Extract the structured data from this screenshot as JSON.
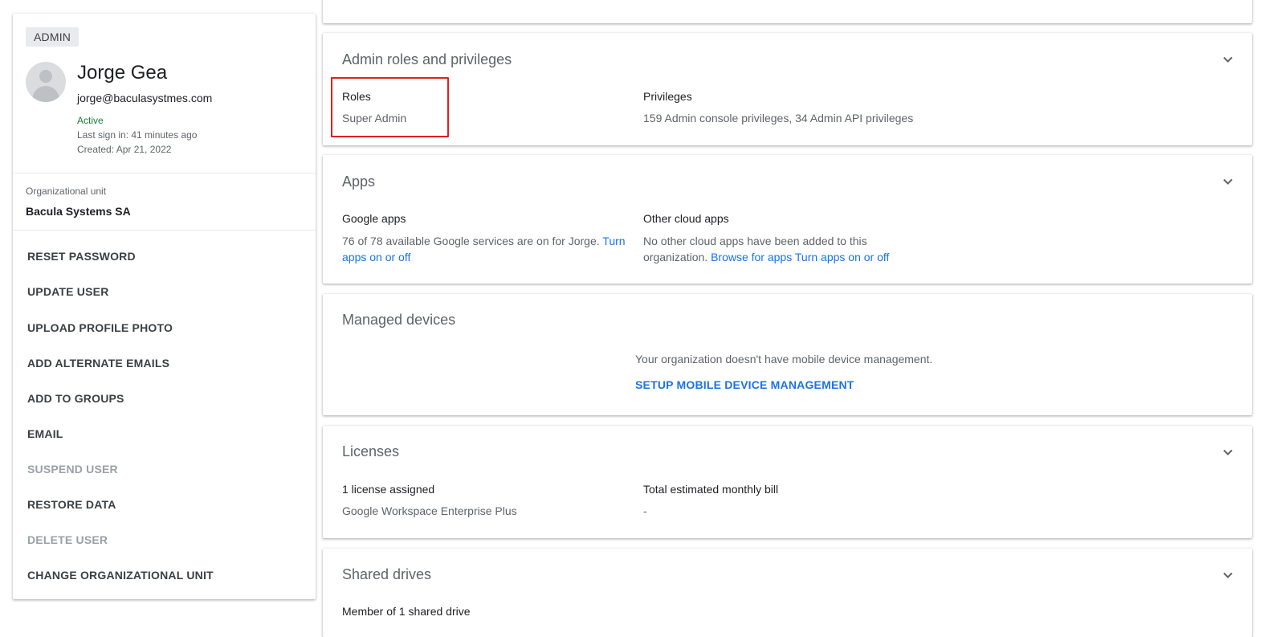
{
  "profile": {
    "role_chip": "ADMIN",
    "name": "Jorge Gea",
    "email": "jorge@baculasystmes.com",
    "status": "Active",
    "last_sign_in": "Last sign in: 41 minutes ago",
    "created": "Created: Apr 21, 2022",
    "org_unit_label": "Organizational unit",
    "org_unit_value": "Bacula Systems SA"
  },
  "actions": [
    {
      "label": "RESET PASSWORD",
      "enabled": true
    },
    {
      "label": "UPDATE USER",
      "enabled": true
    },
    {
      "label": "UPLOAD PROFILE PHOTO",
      "enabled": true
    },
    {
      "label": "ADD ALTERNATE EMAILS",
      "enabled": true
    },
    {
      "label": "ADD TO GROUPS",
      "enabled": true
    },
    {
      "label": "EMAIL",
      "enabled": true
    },
    {
      "label": "SUSPEND USER",
      "enabled": false
    },
    {
      "label": "RESTORE DATA",
      "enabled": true
    },
    {
      "label": "DELETE USER",
      "enabled": false
    },
    {
      "label": "CHANGE ORGANIZATIONAL UNIT",
      "enabled": true
    }
  ],
  "admin_roles": {
    "title": "Admin roles and privileges",
    "roles_label": "Roles",
    "roles_value": "Super Admin",
    "privileges_label": "Privileges",
    "privileges_value": "159 Admin console privileges, 34 Admin API privileges"
  },
  "apps": {
    "title": "Apps",
    "google_label": "Google apps",
    "google_text": "76 of 78 available Google services are on for Jorge.",
    "google_link": "Turn apps on or off",
    "other_label": "Other cloud apps",
    "other_text": "No other cloud apps have been added to this organization.",
    "other_link_browse": "Browse for apps",
    "other_link_turn": "Turn apps on or off"
  },
  "managed_devices": {
    "title": "Managed devices",
    "message": "Your organization doesn't have mobile device management.",
    "setup_link": "SETUP MOBILE DEVICE MANAGEMENT"
  },
  "licenses": {
    "title": "Licenses",
    "assigned_label": "1 license assigned",
    "assigned_value": "Google Workspace Enterprise Plus",
    "bill_label": "Total estimated monthly bill",
    "bill_value": "-"
  },
  "shared_drives": {
    "title": "Shared drives",
    "member_label": "Member of 1 shared drive"
  },
  "colors": {
    "accent": "#1a73e8",
    "status_active": "#188038",
    "highlight": "#e21e1e"
  },
  "icons": {
    "expand": "chevron-down-icon",
    "avatar": "avatar-placeholder-icon"
  }
}
